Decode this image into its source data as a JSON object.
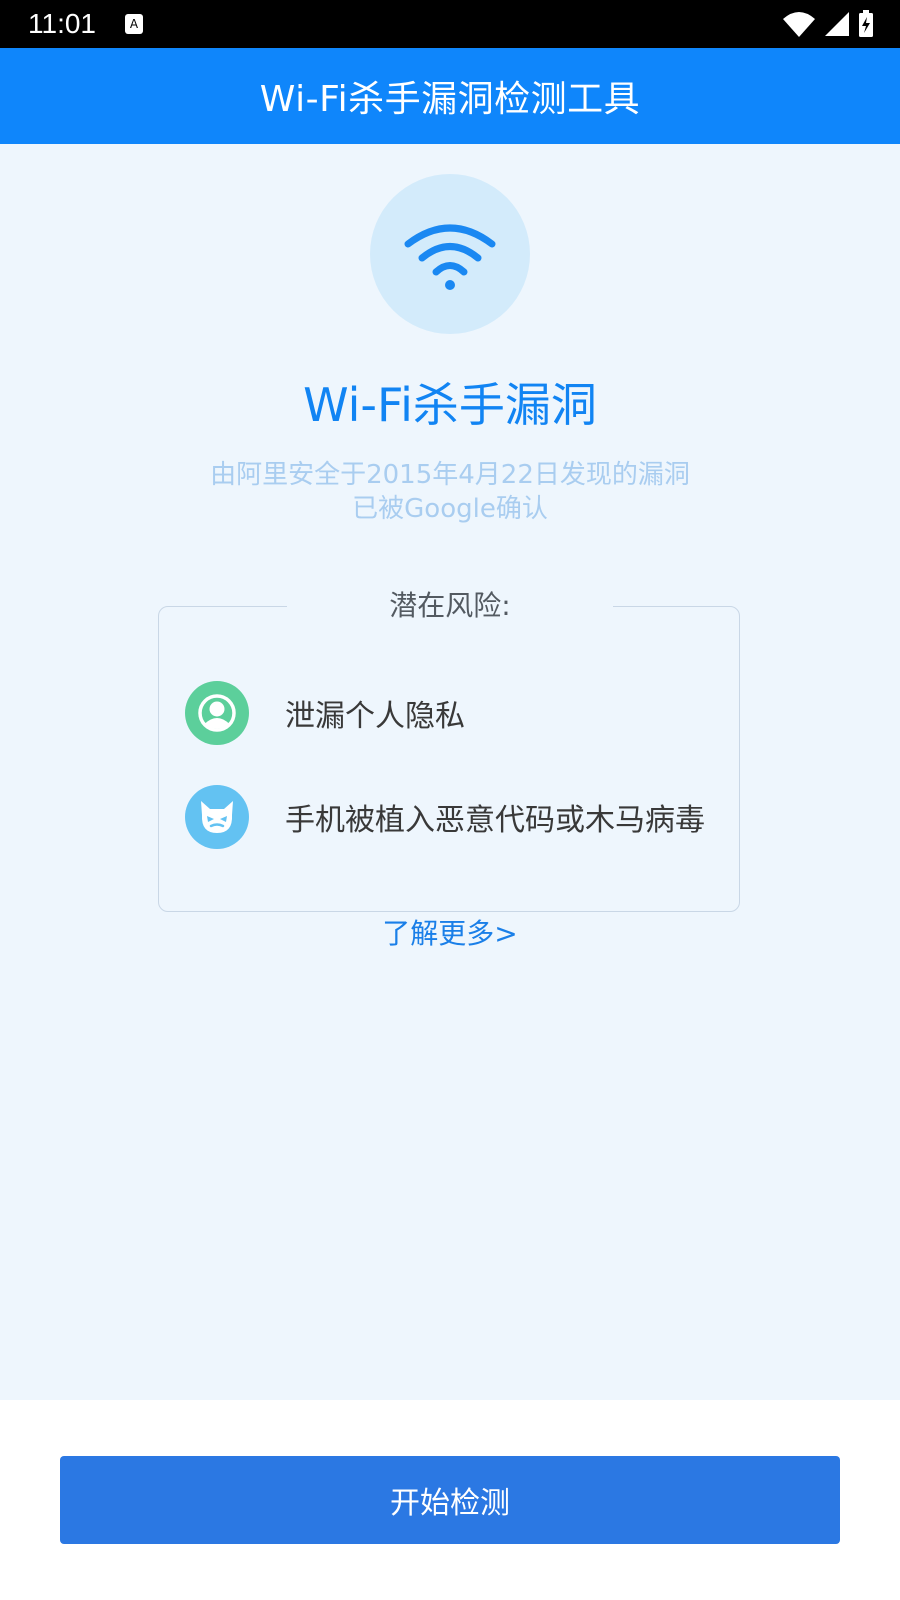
{
  "status_bar": {
    "time": "11:01",
    "icons": [
      "keyboard-a-icon",
      "wifi-signal-icon",
      "cell-signal-icon",
      "battery-charging-icon"
    ]
  },
  "header": {
    "title": "Wi-Fi杀手漏洞检测工具"
  },
  "hero": {
    "icon": "wifi-icon",
    "title": "Wi-Fi杀手漏洞",
    "description_line1": "由阿里安全于2015年4月22日发现的漏洞",
    "description_line2": "已被Google确认"
  },
  "risks": {
    "title": "潜在风险:",
    "items": [
      {
        "icon": "user-privacy-icon",
        "label": "泄漏个人隐私",
        "color": "#5ccf9b"
      },
      {
        "icon": "devil-malware-icon",
        "label": "手机被植入恶意代码或木马病毒",
        "color": "#63c2f2"
      }
    ]
  },
  "learn_more": "了解更多>",
  "actions": {
    "start_label": "开始检测"
  },
  "colors": {
    "primary": "#0f86fb",
    "background": "#eef6fd",
    "button": "#2b78e3",
    "green": "#5ccf9b",
    "light_blue": "#63c2f2"
  }
}
